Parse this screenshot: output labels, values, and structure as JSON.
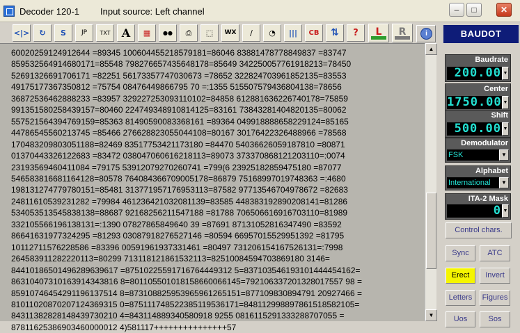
{
  "window": {
    "title": "Decoder 120-1",
    "input_source": "Input source: Left channel",
    "minimize": "–",
    "maximize": "□",
    "close": "✕"
  },
  "toolbar": {
    "buttons": [
      {
        "name": "scope-icon",
        "glyph": "<|>"
      },
      {
        "name": "refresh-icon",
        "glyph": "↻"
      },
      {
        "name": "sync-icon",
        "glyph": "S"
      },
      {
        "name": "save-jp-icon",
        "glyph": "JP"
      },
      {
        "name": "save-txt-icon",
        "glyph": "TXT"
      },
      {
        "name": "font-icon",
        "glyph": "A"
      },
      {
        "name": "window-icon",
        "glyph": "▦"
      },
      {
        "name": "binoculars-icon",
        "glyph": "●●"
      },
      {
        "name": "printer-icon",
        "glyph": "⎙"
      },
      {
        "name": "crop-icon",
        "glyph": "⬚"
      },
      {
        "name": "wx-icon",
        "glyph": "WX"
      },
      {
        "name": "antenna-icon",
        "glyph": "∕"
      },
      {
        "name": "radar-icon",
        "glyph": "◔"
      },
      {
        "name": "barcode-icon",
        "glyph": "|||"
      },
      {
        "name": "cb-icon",
        "glyph": "CB"
      },
      {
        "name": "swap-icon",
        "glyph": "⇅"
      },
      {
        "name": "help-icon",
        "glyph": "?"
      }
    ],
    "left_channel": "L",
    "right_channel": "R",
    "info_glyph": "i"
  },
  "mode": "BAUDOT",
  "decoded_lines": [
    "60020259124912644 =89345 10060445521857918​1=86046 83881478778849837 =83747",
    "85953256491468017​1=85548 79827665743564817​8=85649 34225005776191821​3=78450",
    "52691326691706171 =82251 56173357747030673 =78652 32282470396185213​5=83553",
    "49175177367350812 =75754 08476449866795 70 =:1355 51550757943680413​8=78656",
    "36872536462888233 =83957 32922725309311010​2=84858 61288163622674017​8=75859",
    "99135158025843915​7=80460 22474934891081412​5=83161 73843281404820​135=80062",
    "55752156439476915​9=85363 81490590083368161 =89364 04991888865822912​4=85165",
    "44786545560213745 =85466 27662882305504410​8=80167 30176422326488966 =78568",
    "17048320980305118​8=82469 83517753421173180 =84470 54036626059187810 =80871",
    "01370443326122683 =83472 03804706061621811​3=89073 37337086812120311​0=:0074",
    "23193569460411084 =79175 53912079270260741 =799(6 23925182859475180 =87077",
    "54658381668116412​8=80578 76408436670900517​8=86879 75168997019748363 =:4680",
    "19813127477978015​1=85481 31377195717695311​3=87582 97713546704978672 =82683",
    "24811610539231282 =79984 46123642103208113​9=83585 44838319289020814​1=81286",
    "53405351354583813​8=88687 92168256211547188 =81788 70650661691670311​0=81989",
    "33210556619613813​1=:1390 07827865849640 39 =87691 87131052816347490 =83592",
    "86641631977324295 =81293 03087918276527146 =80594 66957015529951392 =81795",
    "10112711576228586 =83396 00591961937331461 =80497 73120615416752613​1=:7998",
    "26458391128222011​3=80299 71311812186153211​3=82510084594703869180 3146=",
    "84410186501496289639617 =87510225591716764449312 5=837103546193101444454162=",
    "86310407310163914343816 8=801105501018158660066145=792106337201328017557 98 =",
    "85910746454291196137514 8=873108825953965961265151=877109830894791 20927466 =",
    "81011020870207124369315 0=875111748522385119536171=848112998897861518582105=",
    "84311382828148439730210 4=843114889340580918 9255 0816115291333288707055 =",
    "87811625386903460000012 4)581117+++++++++++++++57"
  ],
  "params": {
    "baudrate": {
      "title": "Baudrate",
      "value": "200.00"
    },
    "center": {
      "title": "Center",
      "value": "1750.00"
    },
    "shift": {
      "title": "Shift",
      "value": "500.00"
    },
    "demodulator": {
      "title": "Demodulator",
      "value": "FSK"
    },
    "alphabet": {
      "title": "Alphabet",
      "value": "International"
    },
    "ita2_mask": {
      "title": "ITA-2 Mask",
      "value": "0"
    }
  },
  "buttons": {
    "control_chars": "Control chars.",
    "sync": "Sync",
    "atc": "ATC",
    "erect": "Erect",
    "invert": "Invert",
    "letters": "Letters",
    "figures": "Figures",
    "usos": "Uos",
    "sos": "Sos"
  },
  "colors": {
    "display_text": "#23e0d2",
    "active_button": "#f5f500",
    "mode_header": "#0e1c78"
  }
}
